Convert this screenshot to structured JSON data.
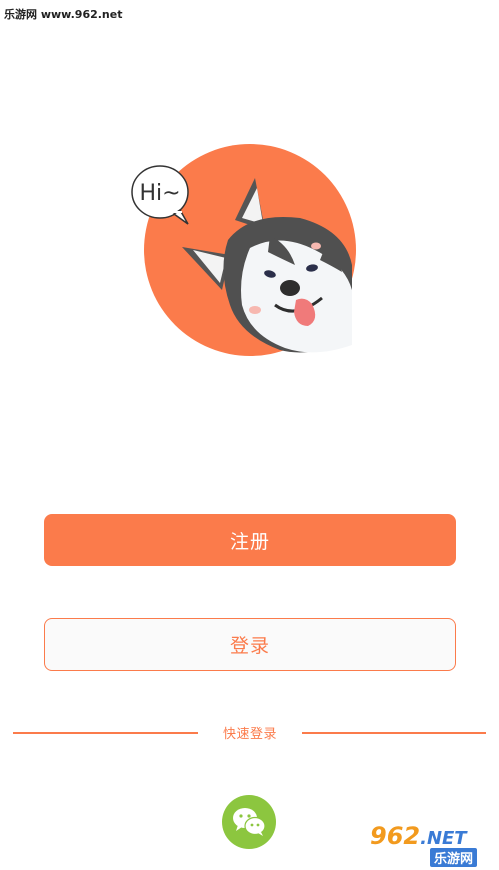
{
  "watermark": {
    "top_left": "乐游网 www.962.net",
    "bottom_right_main": "962",
    "bottom_right_net": ".NET",
    "bottom_right_sub": "乐游网"
  },
  "hero": {
    "speech_bubble": "Hi~",
    "mascot_icon": "husky-dog-icon"
  },
  "actions": {
    "register_label": "注册",
    "login_label": "登录"
  },
  "quick_login": {
    "label": "快速登录",
    "wechat_icon": "wechat-icon"
  },
  "colors": {
    "accent": "#fb7b4b",
    "wechat": "#8cc63f",
    "background": "#ffffff"
  }
}
